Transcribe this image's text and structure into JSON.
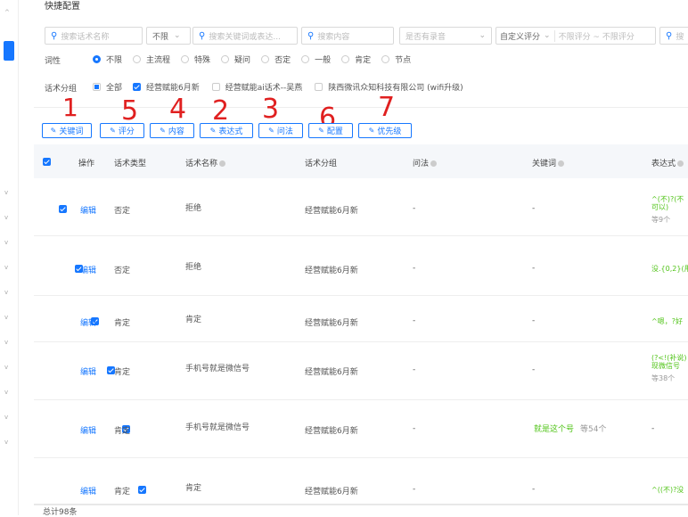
{
  "section_title": "快捷配置",
  "filters": {
    "search_name_placeholder": "搜索话术名称",
    "limit_select": "不限",
    "search_keyword_placeholder": "搜索关键词或表达...",
    "search_content_placeholder": "搜索内容",
    "has_recording_placeholder": "是否有录音",
    "custom_score": "自定义评分",
    "score_range": "不限评分 ~ 不限评分",
    "search_more_placeholder": "搜"
  },
  "cixing": {
    "label": "词性",
    "options": [
      "不限",
      "主流程",
      "特殊",
      "疑问",
      "否定",
      "一般",
      "肯定",
      "节点"
    ],
    "selected": 0
  },
  "group_filter": {
    "label": "话术分组",
    "all_label": "全部",
    "options": [
      {
        "label": "经营赋能6月新",
        "checked": true
      },
      {
        "label": "经营赋能ai话术--吴燕",
        "checked": false
      },
      {
        "label": "陕西微讯众知科技有限公司 (wifi升级)",
        "checked": false
      }
    ]
  },
  "toolbar": [
    "关键词",
    "评分",
    "内容",
    "表达式",
    "问法",
    "配置",
    "优先级"
  ],
  "annotations": [
    "1",
    "5",
    "4",
    "2",
    "3",
    "6",
    "7"
  ],
  "table": {
    "headers": [
      "操作",
      "话术类型",
      "话术名称",
      "话术分组",
      "问法",
      "关键词",
      "表达式"
    ],
    "rows": [
      {
        "op": "编辑",
        "type": "否定",
        "name": "拒绝",
        "group": "经营赋能6月新",
        "wenfa": "-",
        "keyword": "-",
        "keyword_extra": "",
        "expr": "^(不)?(不可以)",
        "expr_extra": "等9个"
      },
      {
        "op": "编辑",
        "type": "否定",
        "name": "拒绝",
        "group": "经营赋能6月新",
        "wenfa": "-",
        "keyword": "-",
        "keyword_extra": "",
        "expr": "没.{0,2}(用",
        "expr_extra": ""
      },
      {
        "op": "编辑",
        "type": "肯定",
        "name": "肯定",
        "group": "经营赋能6月新",
        "wenfa": "-",
        "keyword": "-",
        "keyword_extra": "",
        "expr": "^嗯，?好",
        "expr_extra": ""
      },
      {
        "op": "编辑",
        "type": "肯定",
        "name": "手机号就是微信号",
        "group": "经营赋能6月新",
        "wenfa": "-",
        "keyword": "-",
        "keyword_extra": "",
        "expr": "(?<!(补说)现微信号",
        "expr_extra": "等38个"
      },
      {
        "op": "编辑",
        "type": "肯定",
        "name": "手机号就是微信号",
        "group": "经营赋能6月新",
        "wenfa": "-",
        "keyword": "就是这个号",
        "keyword_extra": "等54个",
        "expr": "-",
        "expr_extra": ""
      },
      {
        "op": "编辑",
        "type": "肯定",
        "name": "肯定",
        "group": "经营赋能6月新",
        "wenfa": "-",
        "keyword": "-",
        "keyword_extra": "",
        "expr": "^((不)?没",
        "expr_extra": ""
      }
    ]
  },
  "footer_total": "总计98条"
}
